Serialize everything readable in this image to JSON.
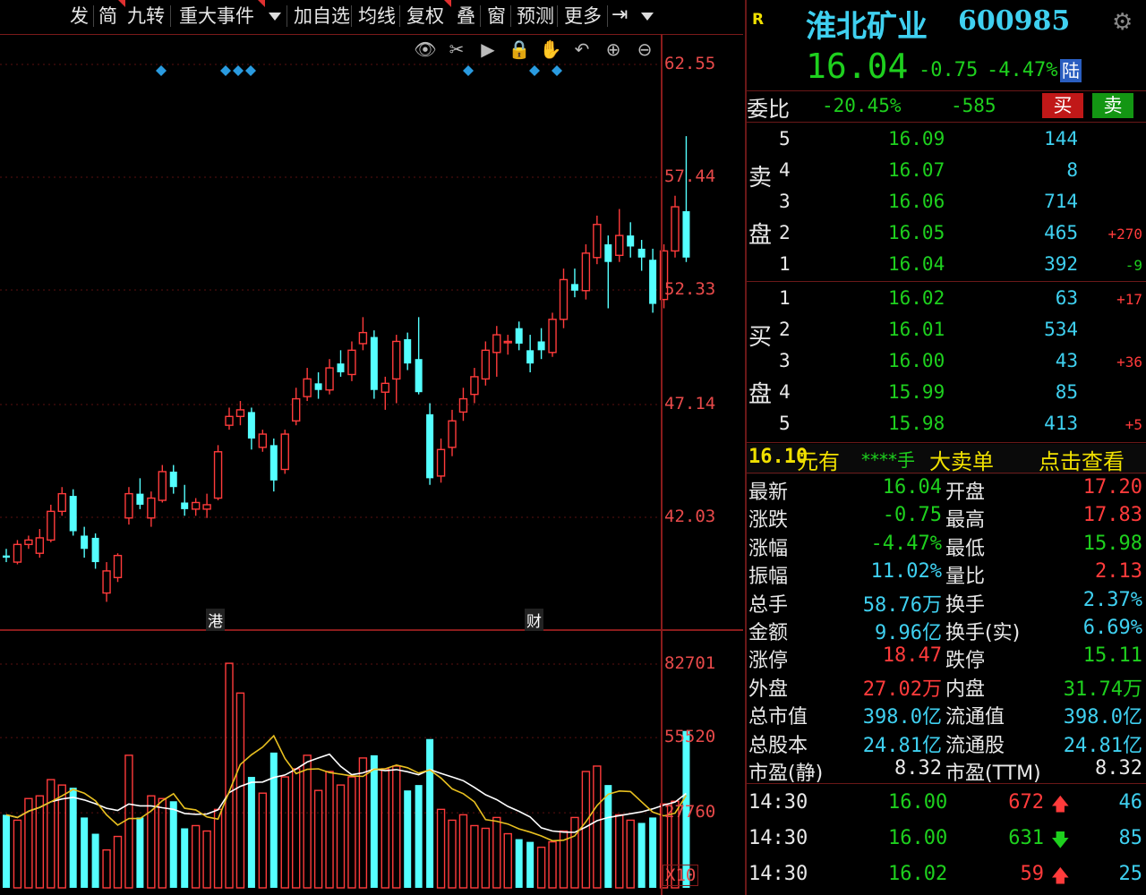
{
  "toolbar": {
    "items": [
      "发",
      "简",
      "九转",
      "重大事件",
      "加自选",
      "均线",
      "复权",
      "叠",
      "窗",
      "预测",
      "更多"
    ]
  },
  "chart_axis": {
    "price_ticks": [
      "62.55",
      "57.44",
      "52.33",
      "47.14",
      "42.03"
    ],
    "volume_ticks": [
      "82701",
      "55520",
      "27760"
    ],
    "volume_unit": "X10",
    "event_markers": [
      "港",
      "财"
    ]
  },
  "chart_data": {
    "type": "candlestick",
    "y_price_ticks": [
      62.55,
      57.44,
      52.33,
      47.14,
      42.03
    ],
    "volume_ticks": [
      82701,
      55520,
      27760
    ],
    "candles": [
      {
        "o": 40.3,
        "h": 40.6,
        "l": 40.0,
        "c": 40.2
      },
      {
        "o": 40.0,
        "h": 41.0,
        "l": 39.9,
        "c": 40.8
      },
      {
        "o": 40.8,
        "h": 41.2,
        "l": 40.6,
        "c": 41.0
      },
      {
        "o": 40.4,
        "h": 41.5,
        "l": 40.2,
        "c": 41.1
      },
      {
        "o": 41.0,
        "h": 42.6,
        "l": 40.9,
        "c": 42.3
      },
      {
        "o": 42.3,
        "h": 43.4,
        "l": 42.1,
        "c": 43.1
      },
      {
        "o": 43.0,
        "h": 43.3,
        "l": 41.2,
        "c": 41.4
      },
      {
        "o": 41.2,
        "h": 41.6,
        "l": 40.2,
        "c": 40.6
      },
      {
        "o": 41.1,
        "h": 41.3,
        "l": 39.7,
        "c": 40.0
      },
      {
        "o": 38.6,
        "h": 40.0,
        "l": 38.2,
        "c": 39.6
      },
      {
        "o": 39.3,
        "h": 40.4,
        "l": 39.1,
        "c": 40.3
      },
      {
        "o": 42.0,
        "h": 43.4,
        "l": 41.7,
        "c": 43.1
      },
      {
        "o": 43.1,
        "h": 43.8,
        "l": 42.4,
        "c": 42.6
      },
      {
        "o": 42.0,
        "h": 43.2,
        "l": 41.6,
        "c": 42.9
      },
      {
        "o": 42.8,
        "h": 44.4,
        "l": 42.7,
        "c": 44.1
      },
      {
        "o": 44.1,
        "h": 44.4,
        "l": 43.1,
        "c": 43.4
      },
      {
        "o": 42.7,
        "h": 43.5,
        "l": 42.1,
        "c": 42.4
      },
      {
        "o": 42.4,
        "h": 42.9,
        "l": 42.1,
        "c": 42.7
      },
      {
        "o": 42.4,
        "h": 43.1,
        "l": 42.0,
        "c": 42.6
      },
      {
        "o": 42.9,
        "h": 45.3,
        "l": 42.8,
        "c": 45.0
      },
      {
        "o": 46.2,
        "h": 47.0,
        "l": 46.0,
        "c": 46.6
      },
      {
        "o": 46.6,
        "h": 47.3,
        "l": 46.2,
        "c": 46.9
      },
      {
        "o": 46.8,
        "h": 47.0,
        "l": 45.1,
        "c": 45.6
      },
      {
        "o": 45.2,
        "h": 46.0,
        "l": 45.0,
        "c": 45.8
      },
      {
        "o": 45.3,
        "h": 45.6,
        "l": 43.2,
        "c": 43.7
      },
      {
        "o": 44.2,
        "h": 46.0,
        "l": 44.0,
        "c": 45.8
      },
      {
        "o": 46.4,
        "h": 47.9,
        "l": 46.2,
        "c": 47.4
      },
      {
        "o": 47.5,
        "h": 48.8,
        "l": 47.3,
        "c": 48.3
      },
      {
        "o": 48.1,
        "h": 48.6,
        "l": 47.4,
        "c": 47.8
      },
      {
        "o": 47.8,
        "h": 49.2,
        "l": 47.6,
        "c": 48.8
      },
      {
        "o": 49.0,
        "h": 49.6,
        "l": 48.4,
        "c": 48.6
      },
      {
        "o": 48.5,
        "h": 50.0,
        "l": 48.2,
        "c": 49.6
      },
      {
        "o": 49.9,
        "h": 51.1,
        "l": 49.6,
        "c": 50.4
      },
      {
        "o": 50.2,
        "h": 50.5,
        "l": 47.4,
        "c": 47.8
      },
      {
        "o": 47.7,
        "h": 48.4,
        "l": 46.9,
        "c": 48.1
      },
      {
        "o": 48.3,
        "h": 50.3,
        "l": 47.2,
        "c": 50.0
      },
      {
        "o": 50.1,
        "h": 50.4,
        "l": 48.7,
        "c": 49.0
      },
      {
        "o": 49.2,
        "h": 51.1,
        "l": 47.6,
        "c": 47.7
      },
      {
        "o": 46.7,
        "h": 47.2,
        "l": 43.5,
        "c": 43.8
      },
      {
        "o": 43.9,
        "h": 45.6,
        "l": 43.6,
        "c": 45.1
      },
      {
        "o": 45.2,
        "h": 46.9,
        "l": 44.8,
        "c": 46.4
      },
      {
        "o": 46.8,
        "h": 47.9,
        "l": 46.4,
        "c": 47.4
      },
      {
        "o": 47.6,
        "h": 48.8,
        "l": 47.2,
        "c": 48.4
      },
      {
        "o": 48.3,
        "h": 50.0,
        "l": 48.0,
        "c": 49.6
      },
      {
        "o": 49.5,
        "h": 50.7,
        "l": 48.4,
        "c": 50.3
      },
      {
        "o": 50.0,
        "h": 50.3,
        "l": 49.4,
        "c": 50.0
      },
      {
        "o": 50.6,
        "h": 50.9,
        "l": 49.6,
        "c": 49.9
      },
      {
        "o": 49.6,
        "h": 50.3,
        "l": 48.6,
        "c": 49.0
      },
      {
        "o": 50.0,
        "h": 50.6,
        "l": 49.2,
        "c": 49.6
      },
      {
        "o": 49.5,
        "h": 51.3,
        "l": 49.3,
        "c": 51.0
      },
      {
        "o": 51.0,
        "h": 53.3,
        "l": 50.6,
        "c": 52.8
      },
      {
        "o": 52.6,
        "h": 53.3,
        "l": 52.0,
        "c": 52.3
      },
      {
        "o": 52.3,
        "h": 54.4,
        "l": 51.9,
        "c": 54.0
      },
      {
        "o": 53.8,
        "h": 55.7,
        "l": 53.5,
        "c": 55.3
      },
      {
        "o": 54.4,
        "h": 54.8,
        "l": 51.5,
        "c": 53.6
      },
      {
        "o": 53.9,
        "h": 56.0,
        "l": 53.6,
        "c": 54.8
      },
      {
        "o": 54.8,
        "h": 55.4,
        "l": 53.8,
        "c": 54.3
      },
      {
        "o": 54.2,
        "h": 54.6,
        "l": 53.2,
        "c": 53.8
      },
      {
        "o": 53.7,
        "h": 54.2,
        "l": 51.3,
        "c": 51.7
      },
      {
        "o": 51.9,
        "h": 54.4,
        "l": 51.5,
        "c": 54.1
      },
      {
        "o": 54.1,
        "h": 56.6,
        "l": 53.8,
        "c": 56.1
      },
      {
        "o": 55.9,
        "h": 59.3,
        "l": 53.6,
        "c": 53.8
      }
    ],
    "volumes": [
      {
        "v": 27000,
        "up": false
      },
      {
        "v": 25000,
        "up": true
      },
      {
        "v": 33000,
        "up": true
      },
      {
        "v": 34000,
        "up": true
      },
      {
        "v": 40000,
        "up": true
      },
      {
        "v": 38000,
        "up": true
      },
      {
        "v": 37000,
        "up": false
      },
      {
        "v": 26000,
        "up": false
      },
      {
        "v": 20000,
        "up": false
      },
      {
        "v": 14000,
        "up": true
      },
      {
        "v": 19000,
        "up": true
      },
      {
        "v": 49000,
        "up": true
      },
      {
        "v": 26000,
        "up": false
      },
      {
        "v": 34000,
        "up": true
      },
      {
        "v": 33000,
        "up": true
      },
      {
        "v": 32000,
        "up": false
      },
      {
        "v": 22000,
        "up": false
      },
      {
        "v": 23000,
        "up": true
      },
      {
        "v": 21000,
        "up": true
      },
      {
        "v": 29000,
        "up": true
      },
      {
        "v": 83000,
        "up": true
      },
      {
        "v": 72000,
        "up": true
      },
      {
        "v": 41000,
        "up": false
      },
      {
        "v": 35000,
        "up": true
      },
      {
        "v": 50000,
        "up": false
      },
      {
        "v": 41000,
        "up": true
      },
      {
        "v": 44000,
        "up": true
      },
      {
        "v": 49000,
        "up": true
      },
      {
        "v": 36000,
        "up": true
      },
      {
        "v": 43000,
        "up": true
      },
      {
        "v": 38000,
        "up": true
      },
      {
        "v": 41000,
        "up": true
      },
      {
        "v": 48000,
        "up": true
      },
      {
        "v": 49000,
        "up": false
      },
      {
        "v": 44000,
        "up": true
      },
      {
        "v": 45000,
        "up": true
      },
      {
        "v": 36000,
        "up": false
      },
      {
        "v": 38000,
        "up": false
      },
      {
        "v": 55000,
        "up": false
      },
      {
        "v": 29000,
        "up": true
      },
      {
        "v": 25000,
        "up": true
      },
      {
        "v": 27000,
        "up": true
      },
      {
        "v": 23000,
        "up": true
      },
      {
        "v": 22000,
        "up": true
      },
      {
        "v": 26000,
        "up": true
      },
      {
        "v": 20000,
        "up": true
      },
      {
        "v": 18000,
        "up": false
      },
      {
        "v": 17000,
        "up": false
      },
      {
        "v": 15000,
        "up": true
      },
      {
        "v": 17000,
        "up": true
      },
      {
        "v": 21000,
        "up": true
      },
      {
        "v": 26000,
        "up": true
      },
      {
        "v": 43000,
        "up": true
      },
      {
        "v": 45000,
        "up": true
      },
      {
        "v": 38000,
        "up": false
      },
      {
        "v": 27000,
        "up": true
      },
      {
        "v": 25000,
        "up": true
      },
      {
        "v": 24000,
        "up": false
      },
      {
        "v": 26000,
        "up": false
      },
      {
        "v": 31000,
        "up": true
      },
      {
        "v": 32000,
        "up": true
      },
      {
        "v": 58000,
        "up": false
      }
    ]
  },
  "quote": {
    "badge": "R",
    "name": "淮北矿业",
    "code": "600985",
    "price": "16.04",
    "change": "-0.75",
    "change_pct": "-4.47%",
    "exchange_tag": "陆",
    "commission_label": "委比",
    "commission_ratio": "-20.45%",
    "commission_diff": "-585",
    "buy_label": "买",
    "sell_label": "卖"
  },
  "orderbook": {
    "sell_label_top": "卖",
    "sell_label_bottom": "盘",
    "buy_label_top": "买",
    "buy_label_bottom": "盘",
    "sells": [
      {
        "level": "5",
        "price": "16.09",
        "vol": "144",
        "delta": ""
      },
      {
        "level": "4",
        "price": "16.07",
        "vol": "8",
        "delta": ""
      },
      {
        "level": "3",
        "price": "16.06",
        "vol": "714",
        "delta": ""
      },
      {
        "level": "2",
        "price": "16.05",
        "vol": "465",
        "delta": "+270"
      },
      {
        "level": "1",
        "price": "16.04",
        "vol": "392",
        "delta": "-9"
      }
    ],
    "buys": [
      {
        "level": "1",
        "price": "16.02",
        "vol": "63",
        "delta": "+17"
      },
      {
        "level": "2",
        "price": "16.01",
        "vol": "534",
        "delta": ""
      },
      {
        "level": "3",
        "price": "16.00",
        "vol": "43",
        "delta": "+36"
      },
      {
        "level": "4",
        "price": "15.99",
        "vol": "85",
        "delta": ""
      },
      {
        "level": "5",
        "price": "15.98",
        "vol": "413",
        "delta": "+5"
      }
    ]
  },
  "alert": {
    "price": "16.10",
    "text": "元有",
    "qty": "****手",
    "type": "大卖单",
    "link": "点击查看"
  },
  "stats": [
    {
      "l1": "最新",
      "v1": "16.04",
      "c1": "g",
      "l2": "开盘",
      "v2": "17.20",
      "c2": "r"
    },
    {
      "l1": "涨跌",
      "v1": "-0.75",
      "c1": "g",
      "l2": "最高",
      "v2": "17.83",
      "c2": "r"
    },
    {
      "l1": "涨幅",
      "v1": "-4.47%",
      "c1": "g",
      "l2": "最低",
      "v2": "15.98",
      "c2": "g"
    },
    {
      "l1": "振幅",
      "v1": "11.02%",
      "c1": "c",
      "l2": "量比",
      "v2": "2.13",
      "c2": "r"
    },
    {
      "l1": "总手",
      "v1": "58.76万",
      "c1": "c",
      "l2": "换手",
      "v2": "2.37%",
      "c2": "c"
    },
    {
      "l1": "金额",
      "v1": "9.96亿",
      "c1": "c",
      "l2": "换手(实)",
      "v2": "6.69%",
      "c2": "c"
    },
    {
      "l1": "涨停",
      "v1": "18.47",
      "c1": "r",
      "l2": "跌停",
      "v2": "15.11",
      "c2": "g"
    },
    {
      "l1": "外盘",
      "v1": "27.02万",
      "c1": "r",
      "l2": "内盘",
      "v2": "31.74万",
      "c2": "g"
    },
    {
      "l1": "总市值",
      "v1": "398.0亿",
      "c1": "c",
      "l2": "流通值",
      "v2": "398.0亿",
      "c2": "c"
    },
    {
      "l1": "总股本",
      "v1": "24.81亿",
      "c1": "c",
      "l2": "流通股",
      "v2": "24.81亿",
      "c2": "c"
    },
    {
      "l1": "市盈(静)",
      "v1": "8.32",
      "c1": "w",
      "l2": "市盈(TTM)",
      "v2": "8.32",
      "c2": "w"
    }
  ],
  "ticks": [
    {
      "time": "14:30",
      "price": "16.00",
      "vol": "672",
      "dir": "up",
      "num": "46"
    },
    {
      "time": "14:30",
      "price": "16.00",
      "vol": "631",
      "dir": "down",
      "num": "85"
    },
    {
      "time": "14:30",
      "price": "16.02",
      "vol": "59",
      "dir": "up",
      "num": "25"
    }
  ]
}
